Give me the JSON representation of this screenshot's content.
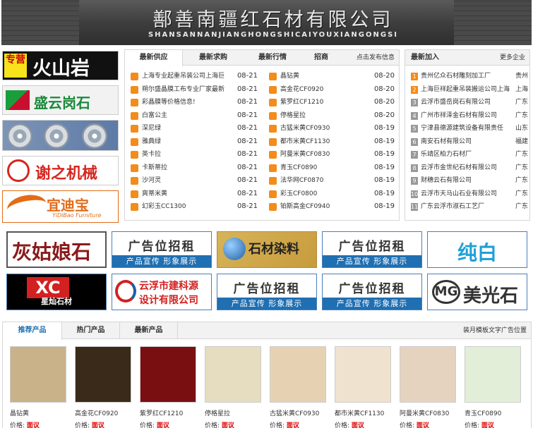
{
  "header": {
    "title_cn": "鄯善南疆红石材有限公司",
    "title_en": "SHANSANNANJIANGHONGSHICAIYOUXIANGONGSI"
  },
  "left_ads": [
    {
      "tag": "专营",
      "text": "火山岩"
    },
    {
      "text": "盛云岗石"
    },
    {
      "text": ""
    },
    {
      "text": "谢之机械"
    },
    {
      "text": "宜迪宝",
      "sub": "YiDiBao Furniture"
    }
  ],
  "news": {
    "tabs": [
      "最新供应",
      "最新求购",
      "最新行情",
      "招商"
    ],
    "right_link": "点击发布信息",
    "left": [
      {
        "t": "上海专业起重吊装公司上海巨",
        "d": "08-21"
      },
      {
        "t": "朔尔盛晶膜工布专业厂家最新",
        "d": "08-21"
      },
      {
        "t": "彩晶膜等价格信息!",
        "d": "08-21"
      },
      {
        "t": "白富公主",
        "d": "08-21"
      },
      {
        "t": "深尼绿",
        "d": "08-21"
      },
      {
        "t": "雅典绿",
        "d": "08-21"
      },
      {
        "t": "英卡拉",
        "d": "08-21"
      },
      {
        "t": "卡斯蒂拉",
        "d": "08-21"
      },
      {
        "t": "沙河灵",
        "d": "08-21"
      },
      {
        "t": "爽蒂米黄",
        "d": "08-21"
      },
      {
        "t": "幻彩玉CC1300",
        "d": "08-21"
      }
    ],
    "right": [
      {
        "t": "晶钻黄",
        "d": "08-20"
      },
      {
        "t": "高金花CF0920",
        "d": "08-20"
      },
      {
        "t": "紫罗红CF1210",
        "d": "08-20"
      },
      {
        "t": "停格星拉",
        "d": "08-20"
      },
      {
        "t": "古猛米黄CF0930",
        "d": "08-19"
      },
      {
        "t": "都市米黄CF1130",
        "d": "08-19"
      },
      {
        "t": "阿曼米黄CF0830",
        "d": "08-19"
      },
      {
        "t": "青玉CF0890",
        "d": "08-19"
      },
      {
        "t": "法华网CF0870",
        "d": "08-19"
      },
      {
        "t": "彩玉CF0800",
        "d": "08-19"
      },
      {
        "t": "铂斯高金CF0940",
        "d": "08-19"
      }
    ]
  },
  "members": {
    "title": "最新加入",
    "more": "更多企业",
    "list": [
      {
        "n": "1",
        "c": "贵州亿众石材雕刻加工厂",
        "r": "贵州"
      },
      {
        "n": "2",
        "c": "上海巨祥起重吊装搬运公司上海",
        "r": "上海"
      },
      {
        "n": "3",
        "c": "云浮市盛岳岗石有限公司",
        "r": "广东"
      },
      {
        "n": "4",
        "c": "广州市祥泽金石材有限公司",
        "r": "广东"
      },
      {
        "n": "5",
        "c": "宁津县德源建筑设备有限责任",
        "r": "山东"
      },
      {
        "n": "6",
        "c": "南安石材有限公司",
        "r": "福建"
      },
      {
        "n": "7",
        "c": "乐靖区柏力石材厂",
        "r": "广东"
      },
      {
        "n": "8",
        "c": "云浮市金世纪石材有限公司",
        "r": "广东"
      },
      {
        "n": "9",
        "c": "财穗云石有限公司",
        "r": "广东"
      },
      {
        "n": "10",
        "c": "云浮市天马山石业有限公司",
        "r": "广东"
      },
      {
        "n": "11",
        "c": "广东云浮市淑石工艺厂",
        "r": "广东"
      }
    ]
  },
  "ad_grid": {
    "rent_big": "广告位招租",
    "rent_sub": "产品宣传 形象展示",
    "huiguniang": "灰姑娘石材",
    "dye": "石材染料",
    "pure": "纯白",
    "xc_logo": "XC",
    "xc_text": "星灿石材",
    "ys_l1": "云浮市建科源",
    "ys_l2": "设计有限公司",
    "mg_mark": "MG",
    "mg_text": "美光石材"
  },
  "products": {
    "tabs": [
      "推荐产品",
      "热门产品",
      "最新产品"
    ],
    "adpos": "装月模板文字广告位置",
    "price_label": "价格:",
    "price_value": "面议",
    "items": [
      {
        "name": "晶钻黄",
        "color": "#c9b18a"
      },
      {
        "name": "高金花CF0920",
        "color": "#3a2a1a"
      },
      {
        "name": "紫罗红CF1210",
        "color": "#7a0f12"
      },
      {
        "name": "停格星拉",
        "color": "#e6dcc0"
      },
      {
        "name": "古猛米黄CF0930",
        "color": "#e6d2b2"
      },
      {
        "name": "都市米黄CF1130",
        "color": "#efe2cf"
      },
      {
        "name": "阿曼米黄CF0830",
        "color": "#e5d3bf"
      },
      {
        "name": "青玉CF0890",
        "color": "#e3eed9"
      }
    ]
  }
}
